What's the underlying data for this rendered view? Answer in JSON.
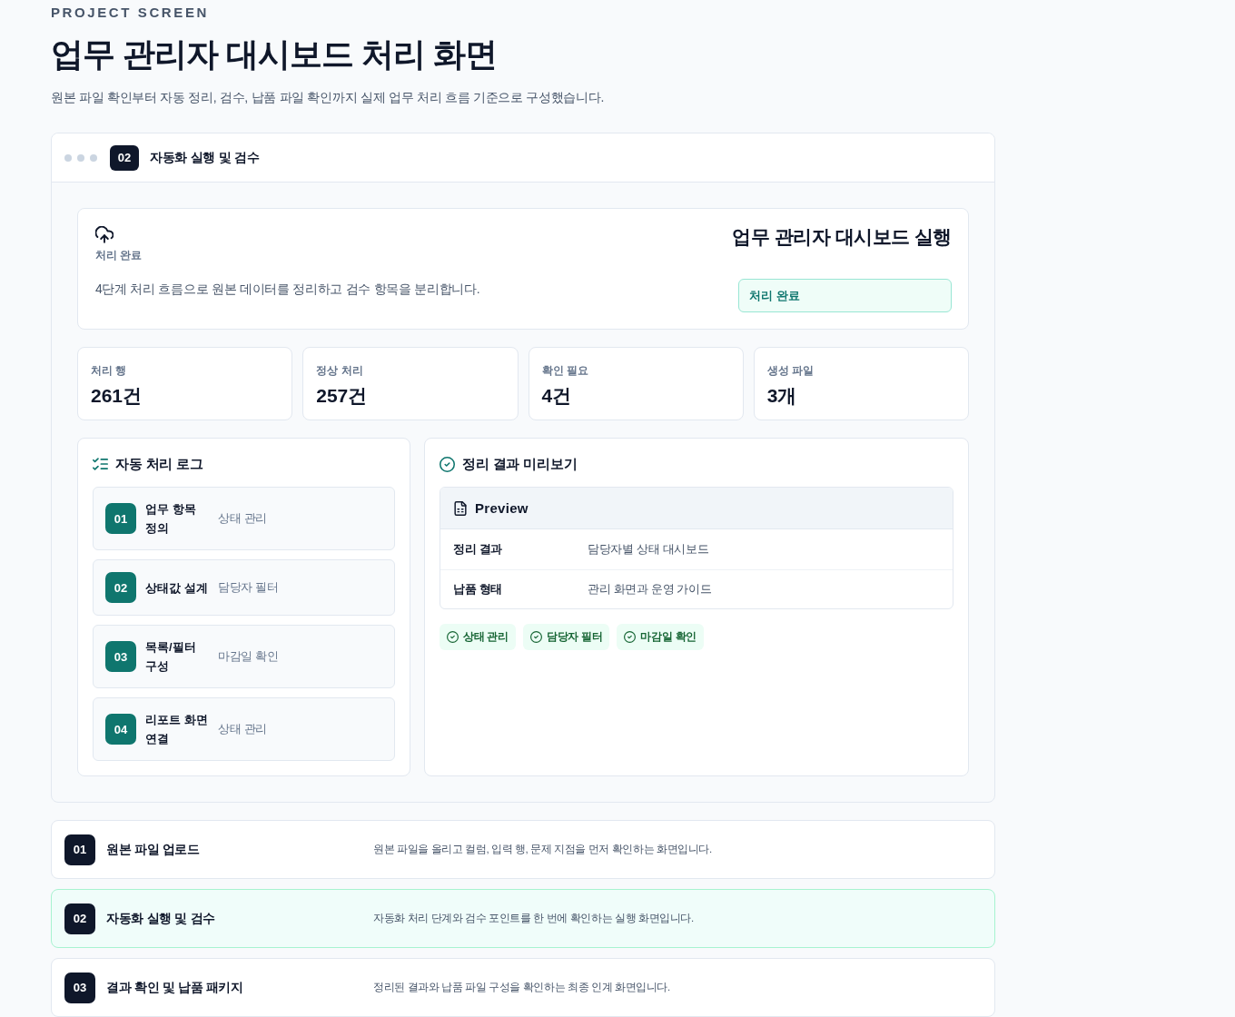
{
  "header": {
    "eyebrow": "PROJECT SCREEN",
    "title": "업무 관리자 대시보드 처리 화면",
    "subtitle": "원본 파일 확인부터 자동 정리, 검수, 납품 파일 확인까지 실제 업무 처리 흐름 기준으로 구성했습니다."
  },
  "panel": {
    "step": "02",
    "title": "자동화 실행 및 검수",
    "hero": {
      "caption": "처리 완료",
      "description": "4단계 처리 흐름으로 원본 데이터를 정리하고 검수 항목을 분리합니다.",
      "title": "업무 관리자 대시보드 실행",
      "status": "처리 완료"
    },
    "stats": [
      {
        "label": "처리 행",
        "value": "261건"
      },
      {
        "label": "정상 처리",
        "value": "257건"
      },
      {
        "label": "확인 필요",
        "value": "4건"
      },
      {
        "label": "생성 파일",
        "value": "3개"
      }
    ],
    "log": {
      "title": "자동 처리 로그",
      "items": [
        {
          "number": "01",
          "title": "업무 항목 정의",
          "note": "상태 관리"
        },
        {
          "number": "02",
          "title": "상태값 설계",
          "note": "담당자 필터"
        },
        {
          "number": "03",
          "title": "목록/필터 구성",
          "note": "마감일 확인"
        },
        {
          "number": "04",
          "title": "리포트 화면 연결",
          "note": "상태 관리"
        }
      ]
    },
    "preview": {
      "title": "정리 결과 미리보기",
      "table_title": "Preview",
      "rows": [
        {
          "label": "정리 결과",
          "value": "담당자별 상태 대시보드"
        },
        {
          "label": "납품 형태",
          "value": "관리 화면과 운영 가이드"
        }
      ],
      "tags": [
        "상태 관리",
        "담당자 필터",
        "마감일 확인"
      ]
    }
  },
  "steps": [
    {
      "number": "01",
      "title": "원본 파일 업로드",
      "description": "원본 파일을 올리고 컬럼, 입력 행, 문제 지점을 먼저 확인하는 화면입니다.",
      "selected": false
    },
    {
      "number": "02",
      "title": "자동화 실행 및 검수",
      "description": "자동화 처리 단계와 검수 포인트를 한 번에 확인하는 실행 화면입니다.",
      "selected": true
    },
    {
      "number": "03",
      "title": "결과 확인 및 납품 패키지",
      "description": "정리된 결과와 납품 파일 구성을 확인하는 최종 인계 화면입니다.",
      "selected": false
    }
  ]
}
